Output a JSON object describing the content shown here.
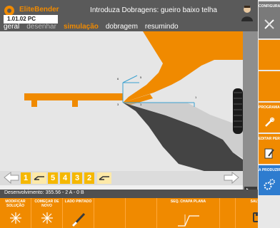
{
  "header": {
    "app_name": "EliteBender",
    "version": "1.01.02 PC",
    "title": "Introduza Dobragens: gueiro baixo telha"
  },
  "tabs": [
    {
      "label": "geral",
      "state": "normal"
    },
    {
      "label": "desenhar",
      "state": "dim"
    },
    {
      "label": "simulação",
      "state": "active"
    },
    {
      "label": "dobragem",
      "state": "normal"
    },
    {
      "label": "resumindo",
      "state": "normal"
    }
  ],
  "canvas": {
    "axis_labels": [
      "5",
      "6",
      "1",
      "3",
      "1"
    ]
  },
  "steps": {
    "items": [
      "1",
      "",
      "5",
      "4",
      "3",
      "2",
      ""
    ],
    "states": [
      "active",
      "icon",
      "active",
      "active",
      "active",
      "active",
      "icon"
    ]
  },
  "status": {
    "text": "Desenvolvimento: 355.56 - 2 A - 0 B"
  },
  "bottom_toolbar": [
    {
      "label": "MODIFICAR SOLUÇÃO",
      "icon": "sparkle-icon"
    },
    {
      "label": "COMEÇAR DE NOVO",
      "icon": "sparkle-icon"
    },
    {
      "label": "LADO PINTADO",
      "icon": "paint-brush-icon"
    },
    {
      "label": "",
      "icon": ""
    },
    {
      "label": "",
      "icon": ""
    },
    {
      "label": "SEQ. CHAPA PLANA",
      "icon": "flat-sheet-icon"
    },
    {
      "label": "",
      "icon": ""
    },
    {
      "label": "SALVAR",
      "icon": "save-icon"
    }
  ],
  "right_panel": [
    {
      "label": "CONFIGURAÇÃO",
      "icon": "tools-icon",
      "color": "gray"
    },
    {
      "label": "",
      "icon": "",
      "color": "orange"
    },
    {
      "label": "",
      "icon": "",
      "color": "orange"
    },
    {
      "label": "PROGRAMAS",
      "icon": "wrench-icon",
      "color": "orange"
    },
    {
      "label": "EDITAR PERFIL",
      "icon": "edit-icon",
      "color": "orange"
    },
    {
      "label": "A PRODUZIR",
      "icon": "gears-icon",
      "color": "blue"
    }
  ],
  "colors": {
    "accent": "#f08a00",
    "header": "#5a5a5a",
    "step": "#f5b800",
    "tool": "#3a3a3a",
    "active_panel": "#2e7ccf"
  }
}
